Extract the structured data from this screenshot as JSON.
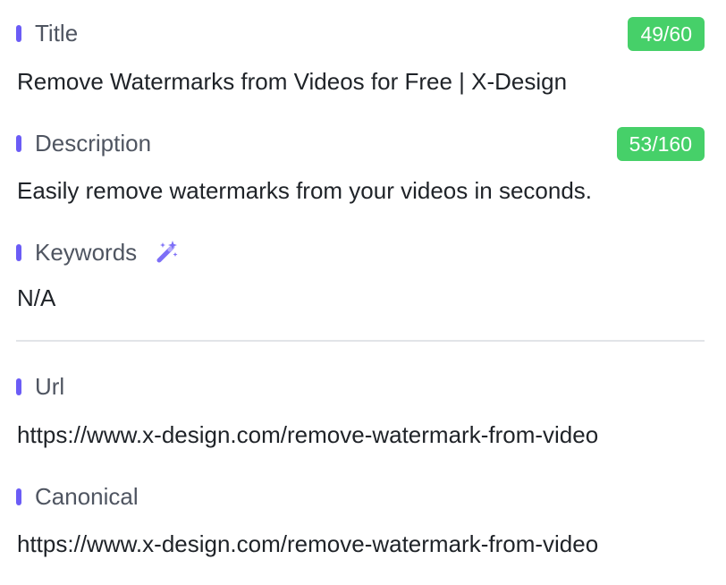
{
  "title": {
    "label": "Title",
    "count": "49/60",
    "value": "Remove Watermarks from Videos for Free | X-Design"
  },
  "description": {
    "label": "Description",
    "count": "53/160",
    "value": "Easily remove watermarks from your videos in seconds."
  },
  "keywords": {
    "label": "Keywords",
    "icon": "magic-wand-icon",
    "value": "N/A"
  },
  "url": {
    "label": "Url",
    "value": "https://www.x-design.com/remove-watermark-from-video"
  },
  "canonical": {
    "label": "Canonical",
    "value": "https://www.x-design.com/remove-watermark-from-video"
  },
  "colors": {
    "accent": "#6b5cf6",
    "badge": "#46d069"
  }
}
